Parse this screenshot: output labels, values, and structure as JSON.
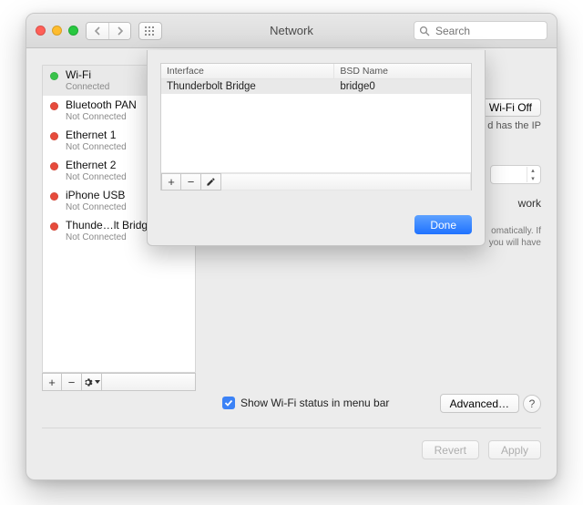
{
  "window": {
    "title": "Network",
    "search_placeholder": "Search"
  },
  "sidebar": {
    "items": [
      {
        "name": "Wi-Fi",
        "status": "Connected",
        "color": "green"
      },
      {
        "name": "Bluetooth PAN",
        "status": "Not Connected",
        "color": "red"
      },
      {
        "name": "Ethernet 1",
        "status": "Not Connected",
        "color": "red"
      },
      {
        "name": "Ethernet 2",
        "status": "Not Connected",
        "color": "red"
      },
      {
        "name": "iPhone USB",
        "status": "Not Connected",
        "color": "red"
      },
      {
        "name": "Thunde…lt Bridge",
        "status": "Not Connected",
        "color": "red"
      }
    ]
  },
  "right": {
    "wifi_off": "Wi-Fi Off",
    "ip_frag": "d has the IP",
    "work_frag": "work",
    "auto1": "omatically. If",
    "auto2": "you will have",
    "show_status": "Show Wi-Fi status in menu bar",
    "advanced": "Advanced…",
    "help": "?"
  },
  "footer": {
    "revert": "Revert",
    "apply": "Apply"
  },
  "sheet": {
    "col1": "Interface",
    "col2": "BSD Name",
    "row1_c1": "Thunderbolt Bridge",
    "row1_c2": "bridge0",
    "done": "Done"
  }
}
